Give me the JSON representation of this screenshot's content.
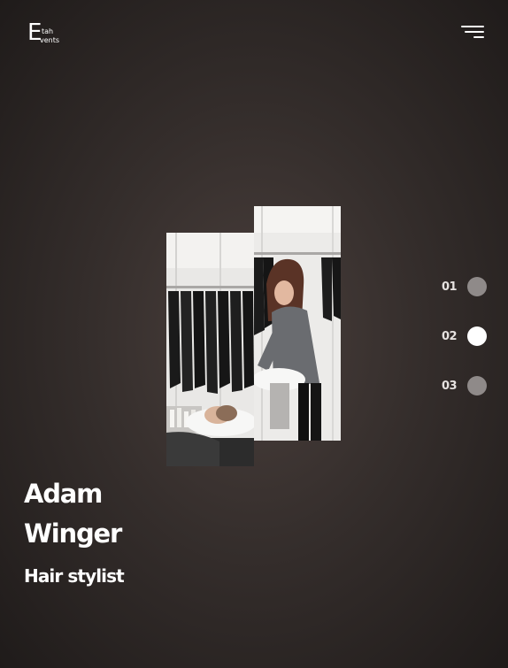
{
  "header": {
    "logo": {
      "letter": "E",
      "line1": "tah",
      "line2": "vents"
    },
    "menu_icon": "hamburger-menu-icon"
  },
  "hero": {
    "photo_left": "salon-hair-wash-photo",
    "photo_right": "hair-stylist-photo",
    "person": {
      "first_name": "Adam",
      "last_name": "Winger",
      "role": "Hair stylist"
    }
  },
  "pagination": {
    "items": [
      {
        "label": "01",
        "active": false
      },
      {
        "label": "02",
        "active": true
      },
      {
        "label": "03",
        "active": false
      }
    ],
    "active_index": 1,
    "colors": {
      "active": "#ffffff",
      "inactive": "#8f8a89"
    }
  },
  "colors": {
    "background": "#352e2c",
    "text": "#ffffff"
  }
}
